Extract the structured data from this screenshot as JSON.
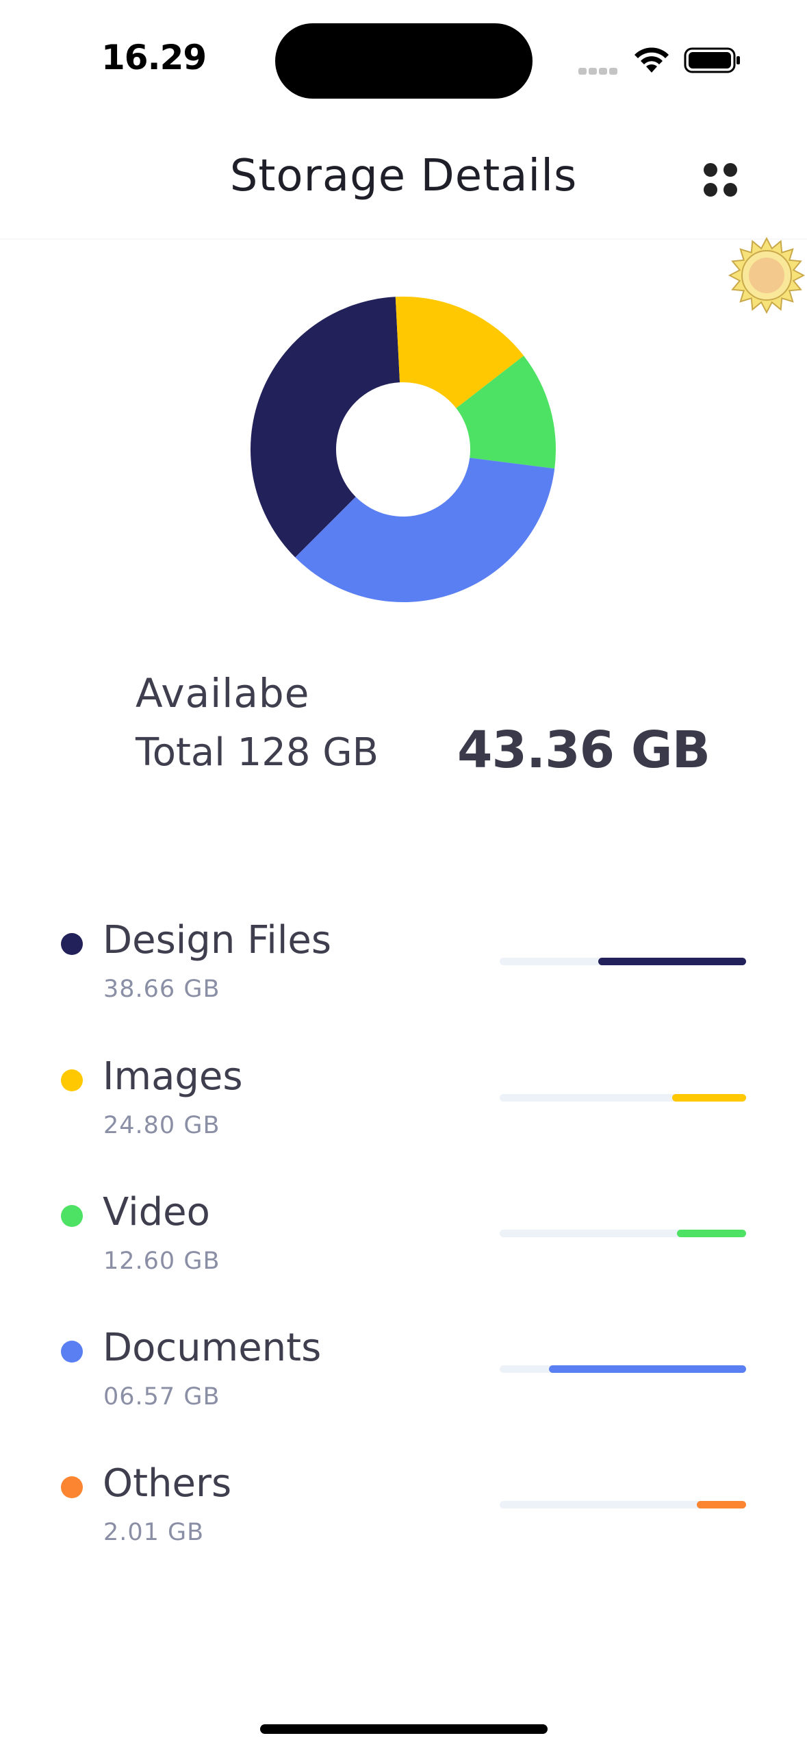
{
  "status_bar": {
    "time": "16.29"
  },
  "header": {
    "title": "Storage Details",
    "menu_icon": "four-dots-grid-icon"
  },
  "theme_icon": "sun-icon",
  "summary": {
    "available_label": "Availabe",
    "total_label": "Total 128 GB",
    "available_value": "43.36 GB"
  },
  "donut": {
    "segments": [
      {
        "name": "Design Files",
        "fraction": 0.367,
        "color": "#23215a"
      },
      {
        "name": "Images",
        "fraction": 0.153,
        "color": "#ffc800"
      },
      {
        "name": "Video",
        "fraction": 0.125,
        "color": "#4de263"
      },
      {
        "name": "Documents",
        "fraction": 0.355,
        "color": "#5a7ff2"
      }
    ]
  },
  "storage": {
    "items": [
      {
        "name": "Design Files",
        "size": "38.66 GB",
        "color": "#23215a",
        "usage": 0.6
      },
      {
        "name": "Images",
        "size": "24.80 GB",
        "color": "#ffc800",
        "usage": 0.3
      },
      {
        "name": "Video",
        "size": "12.60 GB",
        "color": "#4de263",
        "usage": 0.28
      },
      {
        "name": "Documents",
        "size": "06.57 GB",
        "color": "#5a7ff2",
        "usage": 0.8
      },
      {
        "name": "Others",
        "size": "2.01 GB",
        "color": "#fb8530",
        "usage": 0.2
      }
    ]
  }
}
